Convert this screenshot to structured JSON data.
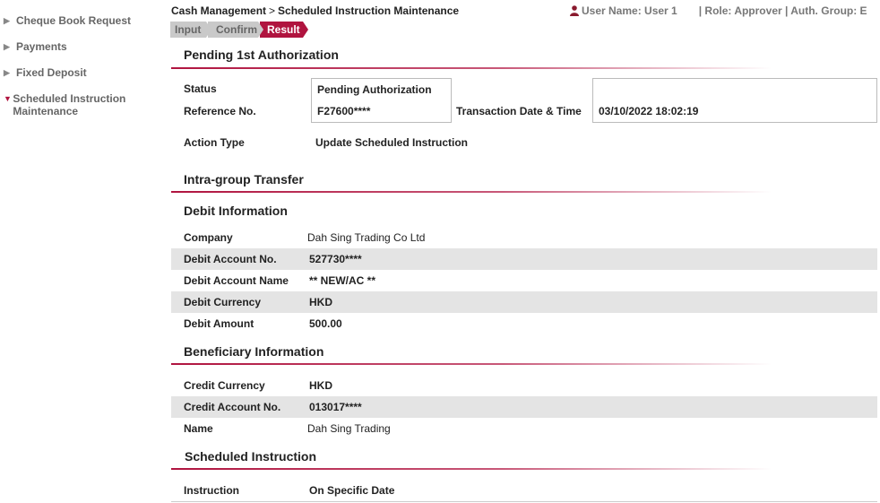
{
  "sidebar": {
    "items": [
      {
        "label": "Cheque Book Request",
        "active": false
      },
      {
        "label": "Payments",
        "active": false
      },
      {
        "label": "Fixed Deposit",
        "active": false
      },
      {
        "label": "Scheduled Instruction Maintenance",
        "active": true
      }
    ]
  },
  "header": {
    "breadcrumb_root": "Cash Management",
    "breadcrumb_sep": ">",
    "breadcrumb_page": "Scheduled Instruction Maintenance",
    "user": "User Name: User 1",
    "role": "| Role: Approver | Auth. Group: E"
  },
  "steps": [
    "Input",
    "Confirm",
    "Result"
  ],
  "pending": {
    "title": "Pending 1st Authorization",
    "status_label": "Status",
    "status_value": "Pending Authorization",
    "reference_label": "Reference No.",
    "reference_value": "F27600****",
    "datetime_label": "Transaction Date & Time",
    "datetime_value": "03/10/2022 18:02:19",
    "action_label": "Action Type",
    "action_value": "Update Scheduled Instruction"
  },
  "transfer": {
    "title": "Intra-group Transfer",
    "debit_title": "Debit Information",
    "debit_rows": [
      {
        "label": "Company",
        "value": "Dah Sing Trading Co Ltd"
      },
      {
        "label": "Debit Account No.",
        "value": "527730****"
      },
      {
        "label": "Debit Account Name",
        "value": "** NEW/AC **"
      },
      {
        "label": "Debit Currency",
        "value": "HKD"
      },
      {
        "label": "Debit Amount",
        "value": "500.00"
      }
    ],
    "beneficiary_title": "Beneficiary Information",
    "beneficiary_rows": [
      {
        "label": "Credit Currency",
        "value": "HKD"
      },
      {
        "label": "Credit Account No.",
        "value": "013017****"
      },
      {
        "label": "Name",
        "value": "Dah Sing Trading"
      }
    ],
    "schedule_title": "Scheduled Instruction",
    "schedule_rows": [
      {
        "label": "Instruction",
        "value": "On Specific Date"
      }
    ]
  },
  "colors": {
    "accent": "#b0143f",
    "step_inactive": "#c9c9c9",
    "row_shade": "#e4e4e4"
  }
}
